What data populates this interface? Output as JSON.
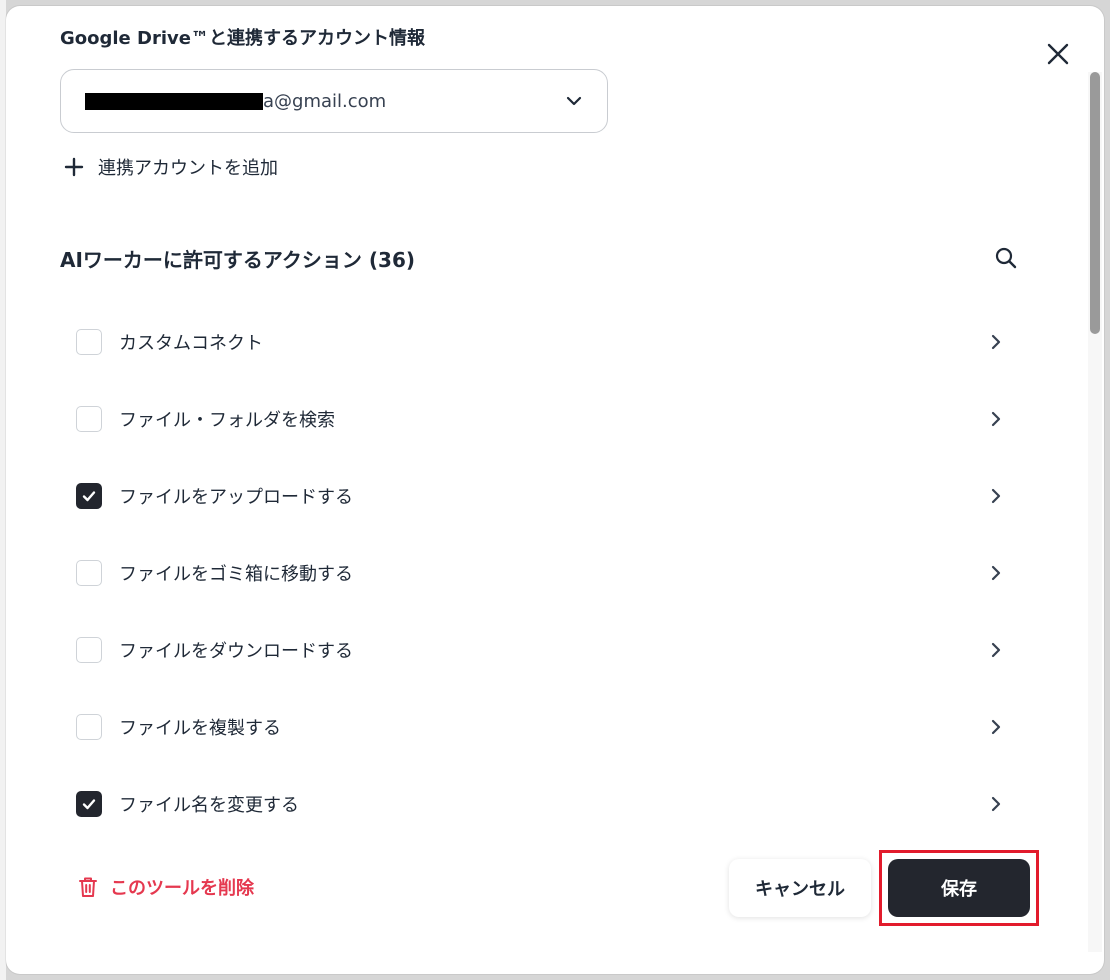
{
  "modal": {
    "section_title": "Google Drive™と連携するアカウント情報",
    "account": {
      "email_suffix": "a@gmail.com"
    },
    "add_account_label": "連携アカウントを追加",
    "actions_title": "AIワーカーに許可するアクション (36)",
    "actions": [
      {
        "label": "カスタムコネクト",
        "checked": false
      },
      {
        "label": "ファイル・フォルダを検索",
        "checked": false
      },
      {
        "label": "ファイルをアップロードする",
        "checked": true
      },
      {
        "label": "ファイルをゴミ箱に移動する",
        "checked": false
      },
      {
        "label": "ファイルをダウンロードする",
        "checked": false
      },
      {
        "label": "ファイルを複製する",
        "checked": false
      },
      {
        "label": "ファイル名を変更する",
        "checked": true
      }
    ],
    "delete_tool_label": "このツールを削除",
    "cancel_label": "キャンセル",
    "save_label": "保存"
  },
  "icons": {
    "close": "close-icon",
    "dropdown": "chevron-down-icon",
    "add": "plus-icon",
    "search": "search-icon",
    "row": "chevron-right-icon",
    "check": "check-icon",
    "delete": "trash-icon"
  },
  "colors": {
    "primary": "#23262e",
    "danger": "#e5384f",
    "highlight": "#e21b2c"
  }
}
